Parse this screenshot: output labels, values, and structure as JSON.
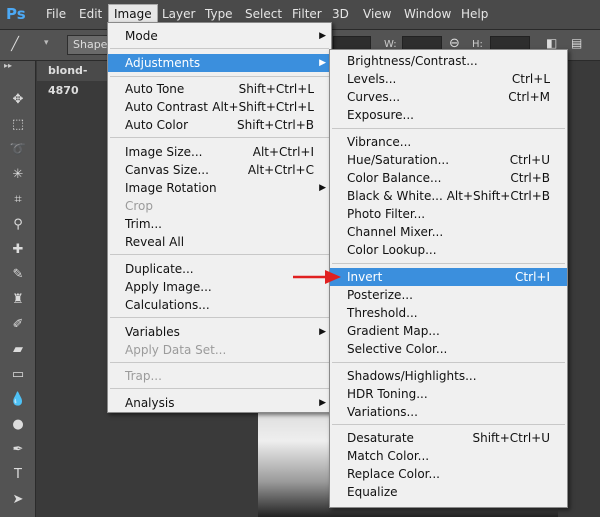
{
  "menubar": {
    "logo": "Ps",
    "items": [
      "File",
      "Edit",
      "Image",
      "Layer",
      "Type",
      "Select",
      "Filter",
      "3D",
      "View",
      "Window",
      "Help"
    ]
  },
  "options": {
    "shape": "Shape",
    "w": "W:",
    "h": "H:"
  },
  "document": {
    "tab": "blond-4870"
  },
  "image_menu": {
    "items": [
      {
        "label": "Mode",
        "shortcut": "",
        "submenu": true
      },
      {
        "label": "Adjustments",
        "shortcut": "",
        "submenu": true,
        "highlighted": true
      },
      {
        "label": "Auto Tone",
        "shortcut": "Shift+Ctrl+L"
      },
      {
        "label": "Auto Contrast",
        "shortcut": "Alt+Shift+Ctrl+L"
      },
      {
        "label": "Auto Color",
        "shortcut": "Shift+Ctrl+B"
      },
      {
        "label": "Image Size...",
        "shortcut": "Alt+Ctrl+I"
      },
      {
        "label": "Canvas Size...",
        "shortcut": "Alt+Ctrl+C"
      },
      {
        "label": "Image Rotation",
        "shortcut": "",
        "submenu": true
      },
      {
        "label": "Crop",
        "shortcut": "",
        "disabled": true
      },
      {
        "label": "Trim...",
        "shortcut": ""
      },
      {
        "label": "Reveal All",
        "shortcut": ""
      },
      {
        "label": "Duplicate...",
        "shortcut": ""
      },
      {
        "label": "Apply Image...",
        "shortcut": ""
      },
      {
        "label": "Calculations...",
        "shortcut": ""
      },
      {
        "label": "Variables",
        "shortcut": "",
        "submenu": true
      },
      {
        "label": "Apply Data Set...",
        "shortcut": "",
        "disabled": true
      },
      {
        "label": "Trap...",
        "shortcut": "",
        "disabled": true
      },
      {
        "label": "Analysis",
        "shortcut": "",
        "submenu": true
      }
    ]
  },
  "adjustments_menu": {
    "items": [
      {
        "label": "Brightness/Contrast...",
        "shortcut": ""
      },
      {
        "label": "Levels...",
        "shortcut": "Ctrl+L"
      },
      {
        "label": "Curves...",
        "shortcut": "Ctrl+M"
      },
      {
        "label": "Exposure...",
        "shortcut": ""
      },
      {
        "label": "Vibrance...",
        "shortcut": ""
      },
      {
        "label": "Hue/Saturation...",
        "shortcut": "Ctrl+U"
      },
      {
        "label": "Color Balance...",
        "shortcut": "Ctrl+B"
      },
      {
        "label": "Black & White...",
        "shortcut": "Alt+Shift+Ctrl+B"
      },
      {
        "label": "Photo Filter...",
        "shortcut": ""
      },
      {
        "label": "Channel Mixer...",
        "shortcut": ""
      },
      {
        "label": "Color Lookup...",
        "shortcut": ""
      },
      {
        "label": "Invert",
        "shortcut": "Ctrl+I",
        "highlighted": true
      },
      {
        "label": "Posterize...",
        "shortcut": ""
      },
      {
        "label": "Threshold...",
        "shortcut": ""
      },
      {
        "label": "Gradient Map...",
        "shortcut": ""
      },
      {
        "label": "Selective Color...",
        "shortcut": ""
      },
      {
        "label": "Shadows/Highlights...",
        "shortcut": ""
      },
      {
        "label": "HDR Toning...",
        "shortcut": ""
      },
      {
        "label": "Variations...",
        "shortcut": ""
      },
      {
        "label": "Desaturate",
        "shortcut": "Shift+Ctrl+U"
      },
      {
        "label": "Match Color...",
        "shortcut": ""
      },
      {
        "label": "Replace Color...",
        "shortcut": ""
      },
      {
        "label": "Equalize",
        "shortcut": ""
      }
    ]
  },
  "colors": {
    "highlight": "#3b8fdd",
    "annotation_arrow": "#e02020",
    "ps_logo": "#4ca9f5"
  }
}
